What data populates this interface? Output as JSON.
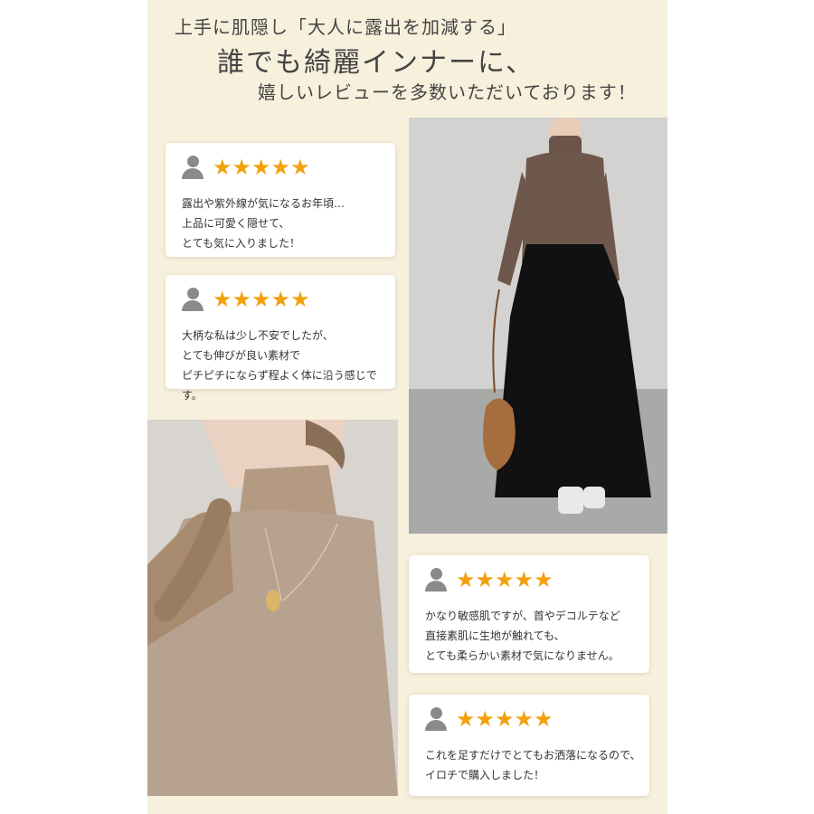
{
  "headline": {
    "line1": "上手に肌隠し「大人に露出を加減する」",
    "line2": "誰でも綺麗インナーに、",
    "line3": "嬉しいレビューを多数いただいております！"
  },
  "stars": "★★★★★",
  "reviews": [
    {
      "text": "露出や紫外線が気になるお年頃…\n上品に可愛く隠せて、\nとても気に入りました！"
    },
    {
      "text": "大柄な私は少し不安でしたが、\nとても伸びが良い素材で\nピチピチにならず程よく体に沿う感じです。"
    },
    {
      "text": "かなり敏感肌ですが、首やデコルテなど\n直接素肌に生地が触れても、\nとても柔らかい素材で気になりません。"
    },
    {
      "text": "これを足すだけでとてもお洒落になるので、\nイロチで購入しました！"
    }
  ],
  "colors": {
    "panel": "#f7f0dc",
    "star": "#f2a10c",
    "icon": "#8a8a8a"
  }
}
